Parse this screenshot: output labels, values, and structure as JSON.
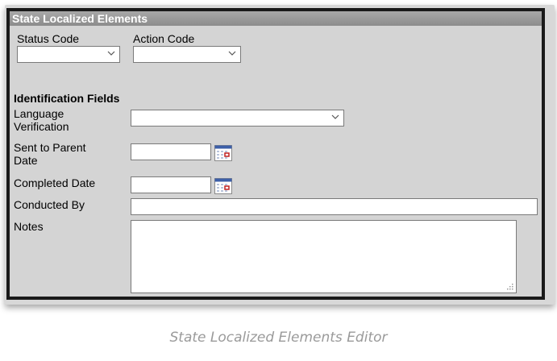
{
  "panel": {
    "title": "State Localized Elements"
  },
  "fields": {
    "status_code": {
      "label": "Status Code",
      "value": ""
    },
    "action_code": {
      "label": "Action Code",
      "value": ""
    }
  },
  "identification": {
    "section_title": "Identification Fields",
    "language_verification": {
      "label_line1": "Language",
      "label_line2": "Verification",
      "value": ""
    },
    "sent_to_parent_date": {
      "label_line1": "Sent to Parent",
      "label_line2": "Date",
      "value": ""
    },
    "completed_date": {
      "label": "Completed Date",
      "value": ""
    },
    "conducted_by": {
      "label": "Conducted By",
      "value": ""
    },
    "notes": {
      "label": "Notes",
      "value": ""
    }
  },
  "caption": "State Localized Elements Editor",
  "colors": {
    "header_bg": "#999999",
    "panel_bg": "#d4d4d4",
    "frame": "#1a1a1a",
    "caption": "#9a9a9a"
  }
}
